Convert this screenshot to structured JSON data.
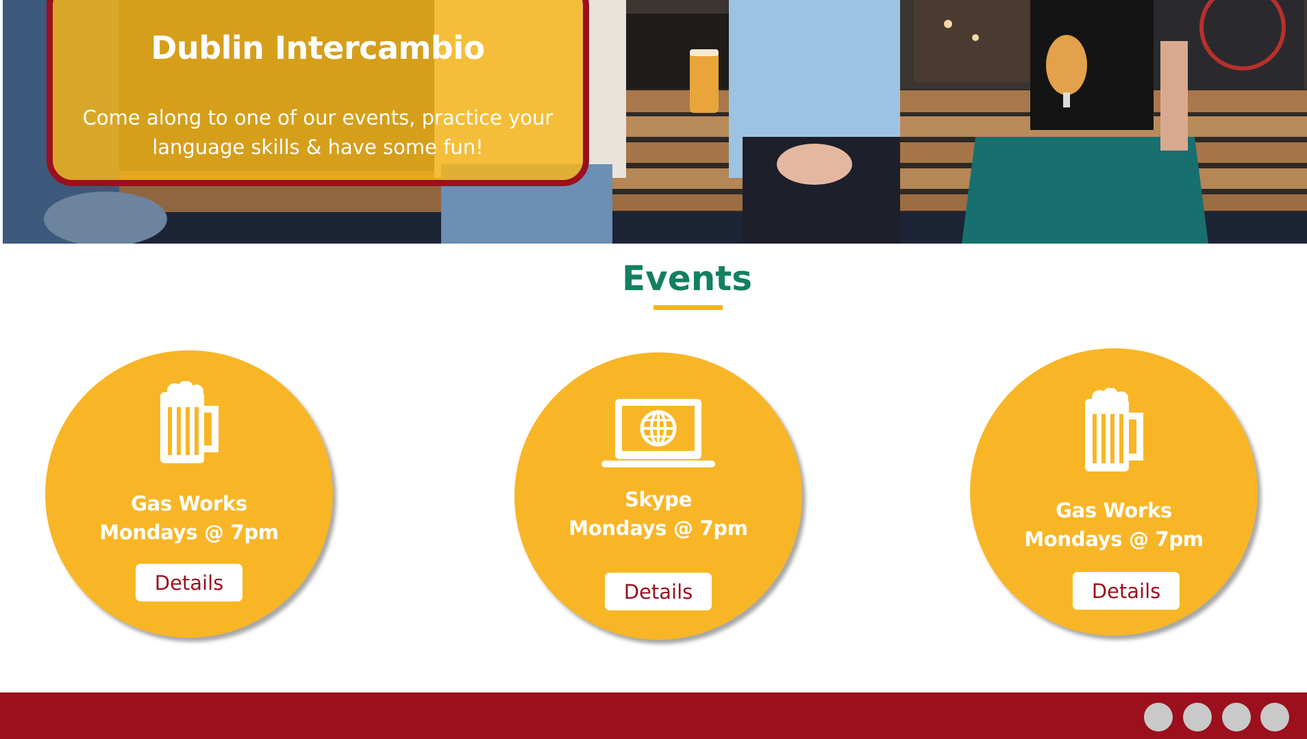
{
  "hero": {
    "title": "Dublin Intercambio",
    "subtitle": "Come along to one of our events, practice your language skills & have some fun!"
  },
  "events": {
    "heading": "Events",
    "cards": [
      {
        "icon": "beer-mug-icon",
        "name": "Gas Works",
        "time": "Mondays @ 7pm",
        "button_label": "Details"
      },
      {
        "icon": "laptop-globe-icon",
        "name": "Skype",
        "time": "Mondays @ 7pm",
        "button_label": "Details"
      },
      {
        "icon": "beer-mug-icon",
        "name": "Gas Works",
        "time": "Mondays @ 7pm",
        "button_label": "Details"
      }
    ]
  },
  "footer": {
    "social_icons": [
      "social-icon",
      "social-icon",
      "social-icon",
      "social-icon"
    ]
  },
  "colors": {
    "brand_red": "#9c0f1d",
    "accent_yellow": "#f8b626",
    "heading_green": "#138060",
    "button_text": "#9c0f1d",
    "social_grey": "#c9c9c9"
  }
}
